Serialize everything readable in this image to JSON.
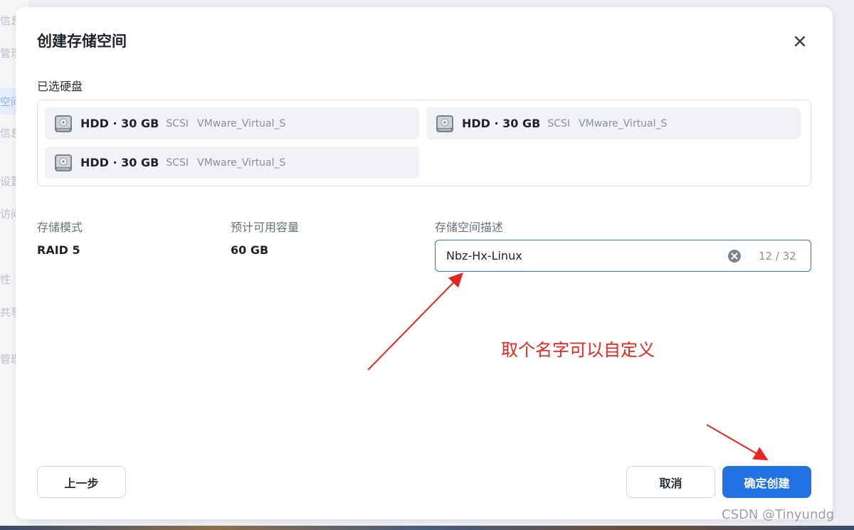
{
  "background": {
    "sidebar_fragments": [
      "信息",
      "管理",
      "空间",
      "信息",
      "设置",
      "访问",
      "性",
      "共享",
      "管理"
    ]
  },
  "dialog": {
    "title": "创建存储空间",
    "selected_disks_label": "已选硬盘",
    "disks": [
      {
        "name": "HDD · 30 GB",
        "interface": "SCSI",
        "model": "VMware_Virtual_S"
      },
      {
        "name": "HDD · 30 GB",
        "interface": "SCSI",
        "model": "VMware_Virtual_S"
      },
      {
        "name": "HDD · 30 GB",
        "interface": "SCSI",
        "model": "VMware_Virtual_S"
      }
    ],
    "storage_mode_label": "存储模式",
    "storage_mode_value": "RAID 5",
    "capacity_label": "预计可用容量",
    "capacity_value": "60 GB",
    "description_label": "存储空间描述",
    "description_value": "Nbz-Hx-Linux",
    "description_counter": "12 / 32",
    "prev_button": "上一步",
    "cancel_button": "取消",
    "confirm_button": "确定创建"
  },
  "annotation": {
    "text": "取个名字可以自定义",
    "color": "#e8261f"
  },
  "watermark": "CSDN @Tinyundg",
  "colors": {
    "accent": "#2272e3",
    "input_border": "#2d77e0"
  }
}
